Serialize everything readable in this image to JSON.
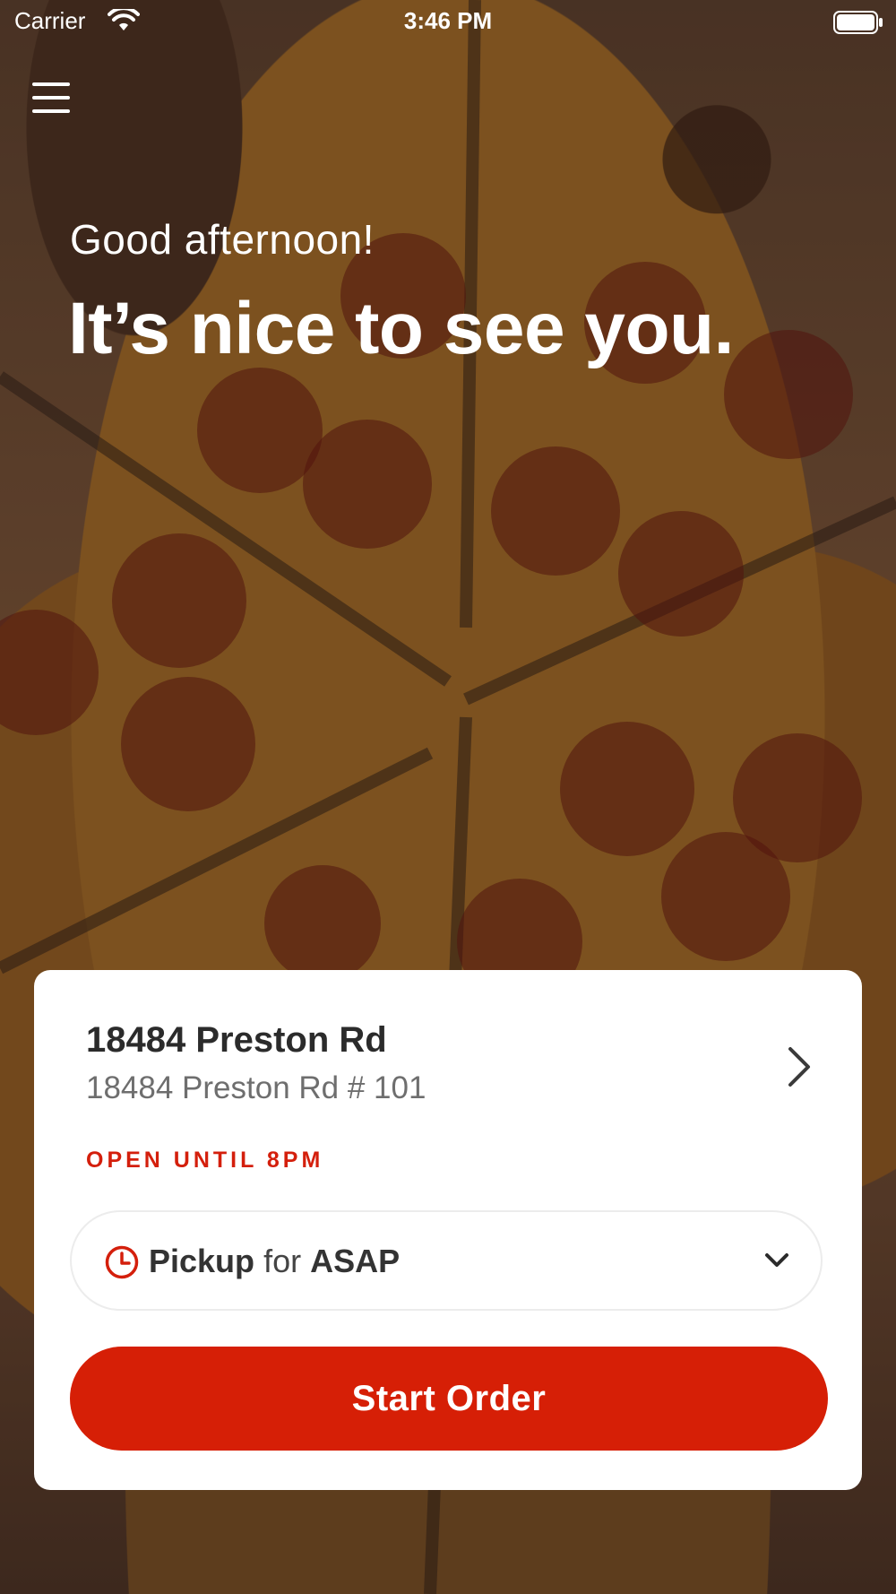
{
  "status_bar": {
    "carrier": "Carrier",
    "time": "3:46 PM"
  },
  "greeting": {
    "small": "Good afternoon!",
    "big": "It’s nice to see you."
  },
  "store": {
    "name": "18484 Preston Rd",
    "address": "18484 Preston Rd # 101",
    "hours": "OPEN UNTIL 8PM"
  },
  "order_type": {
    "mode": "Pickup",
    "connector": "for",
    "time": "ASAP"
  },
  "actions": {
    "start_order_label": "Start Order"
  },
  "colors": {
    "accent": "#d61f06",
    "hours_text": "#d41f0c"
  },
  "icons": [
    "wifi-icon",
    "battery-icon",
    "menu-icon",
    "chevron-right-icon",
    "clock-icon",
    "chevron-down-icon"
  ]
}
